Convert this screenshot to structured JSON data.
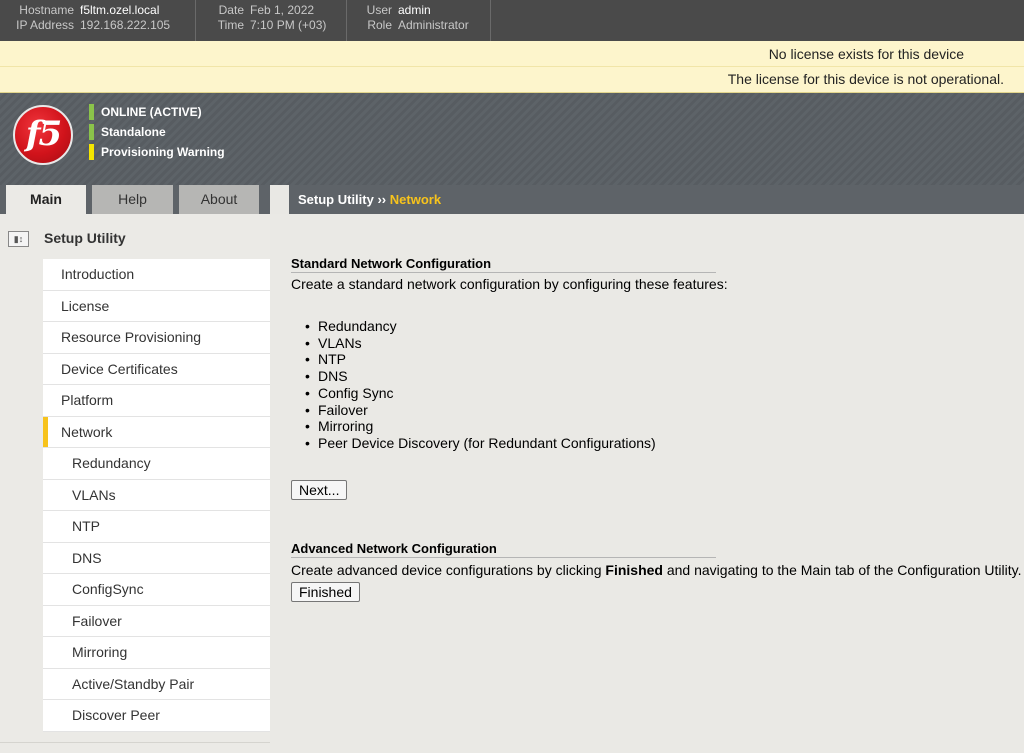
{
  "topbar": {
    "hostname_label": "Hostname",
    "hostname": "f5ltm.ozel.local",
    "ip_label": "IP Address",
    "ip": "192.168.222.105",
    "date_label": "Date",
    "date": "Feb 1, 2022",
    "time_label": "Time",
    "time": "7:10 PM (+03)",
    "user_label": "User",
    "user": "admin",
    "role_label": "Role",
    "role": "Administrator"
  },
  "banner": {
    "line1": "No license exists for this device",
    "line2": "The license for this device is not operational."
  },
  "logo": {
    "text": "f5"
  },
  "status": [
    {
      "label": "ONLINE (ACTIVE)",
      "color": "#8bc34a"
    },
    {
      "label": "Standalone",
      "color": "#8bc34a"
    },
    {
      "label": "Provisioning Warning",
      "color": "#f5e600"
    }
  ],
  "tabs": {
    "main": "Main",
    "help": "Help",
    "about": "About"
  },
  "breadcrumb": {
    "root": "Setup Utility",
    "sep": "››",
    "current": "Network"
  },
  "sidebar": {
    "title": "Setup Utility",
    "items": [
      {
        "label": "Introduction"
      },
      {
        "label": "License"
      },
      {
        "label": "Resource Provisioning"
      },
      {
        "label": "Device Certificates"
      },
      {
        "label": "Platform"
      },
      {
        "label": "Network"
      },
      {
        "label": "Redundancy"
      },
      {
        "label": "VLANs"
      },
      {
        "label": "NTP"
      },
      {
        "label": "DNS"
      },
      {
        "label": "ConfigSync"
      },
      {
        "label": "Failover"
      },
      {
        "label": "Mirroring"
      },
      {
        "label": "Active/Standby Pair"
      },
      {
        "label": "Discover Peer"
      }
    ]
  },
  "standard": {
    "title": "Standard Network Configuration",
    "desc": "Create a standard network configuration by configuring these features:",
    "features": [
      "Redundancy",
      "VLANs",
      "NTP",
      "DNS",
      "Config Sync",
      "Failover",
      "Mirroring",
      "Peer Device Discovery (for Redundant Configurations)"
    ],
    "next_label": "Next..."
  },
  "advanced": {
    "title": "Advanced Network Configuration",
    "desc_pre": "Create advanced device configurations by clicking ",
    "desc_bold": "Finished",
    "desc_post": " and navigating to the Main tab of the Configuration Utility.",
    "finished_label": "Finished"
  },
  "colors": {
    "accent": "#f7c31c",
    "brand_red": "#d1131b",
    "header_gray": "#5e6368"
  }
}
